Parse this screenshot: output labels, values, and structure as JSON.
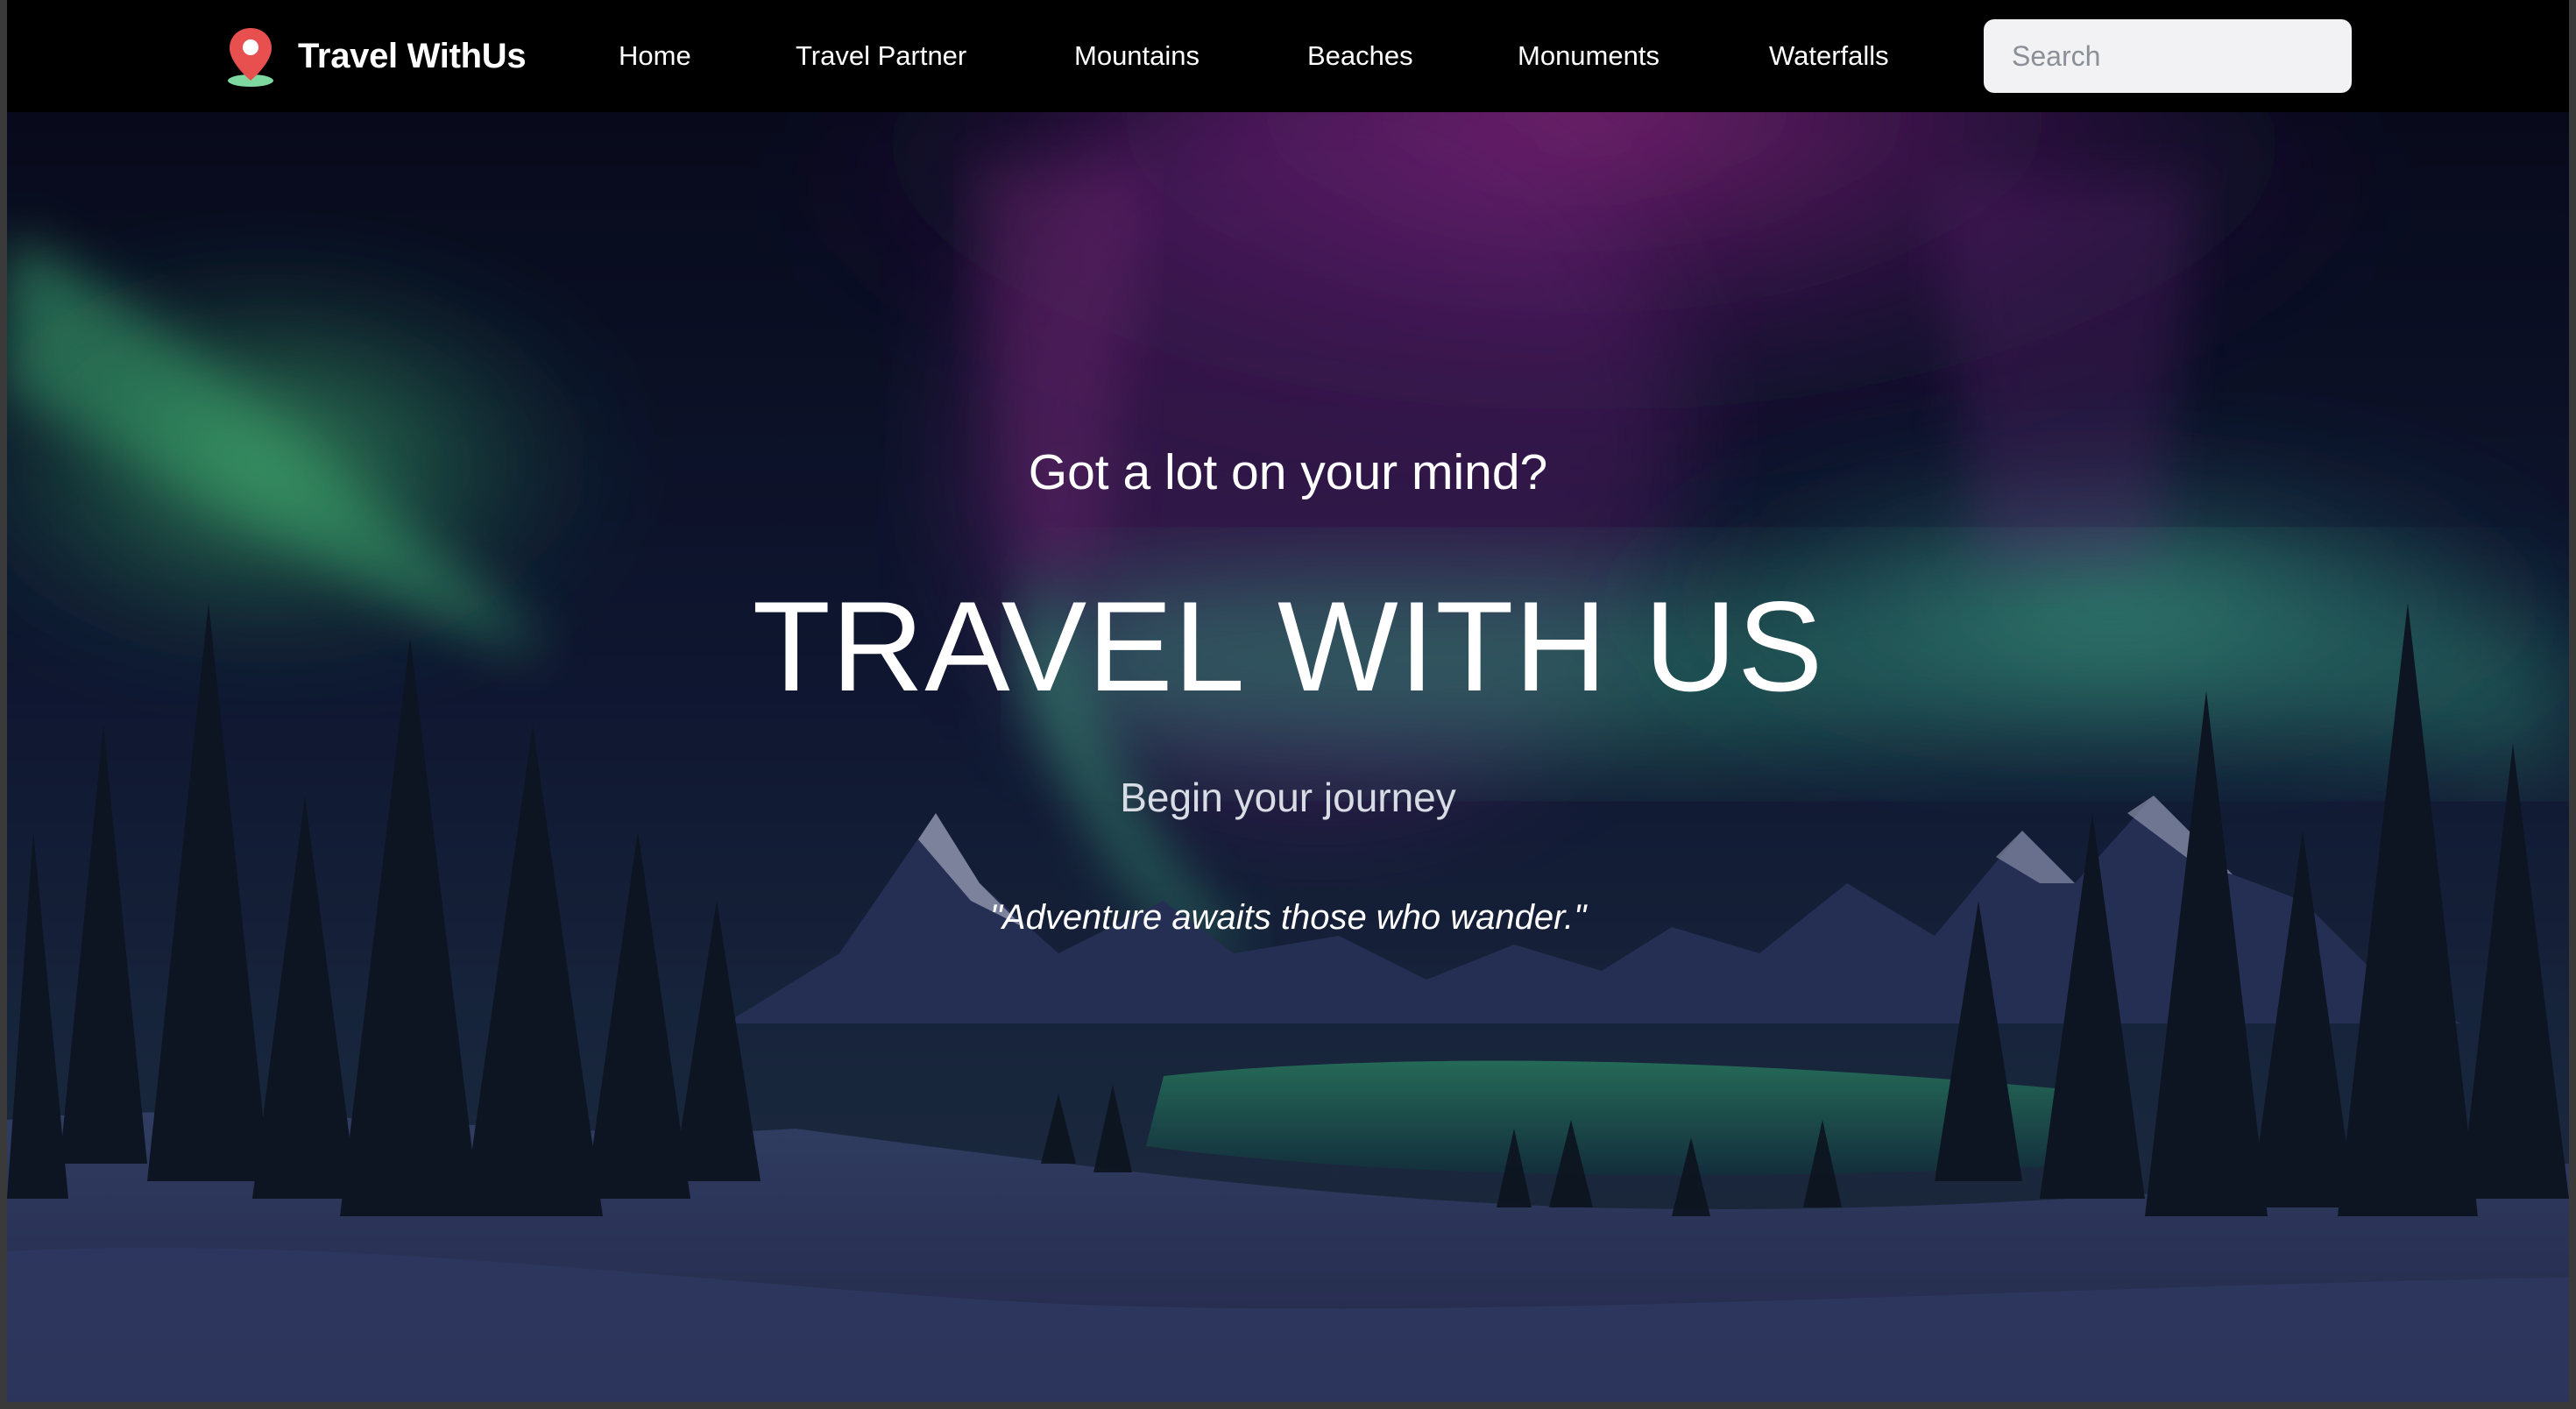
{
  "navbar": {
    "brand": {
      "name": "Travel WithUs",
      "icon": "map-pin-icon",
      "icon_color": "#e8504f"
    },
    "links": [
      "Home",
      "Travel Partner",
      "Mountains",
      "Beaches",
      "Monuments",
      "Waterfalls"
    ],
    "search": {
      "placeholder": "Search",
      "value": ""
    }
  },
  "hero": {
    "tagline": "Got a lot on your mind?",
    "title": "TRAVEL WITH US",
    "subtitle": "Begin your journey",
    "quote": "\"Adventure awaits those who wander.\""
  },
  "colors": {
    "navbar_bg": "#000000",
    "aurora_green": "#3fbf7f",
    "aurora_purple": "#b02aa0",
    "sky": "#0d1430"
  }
}
